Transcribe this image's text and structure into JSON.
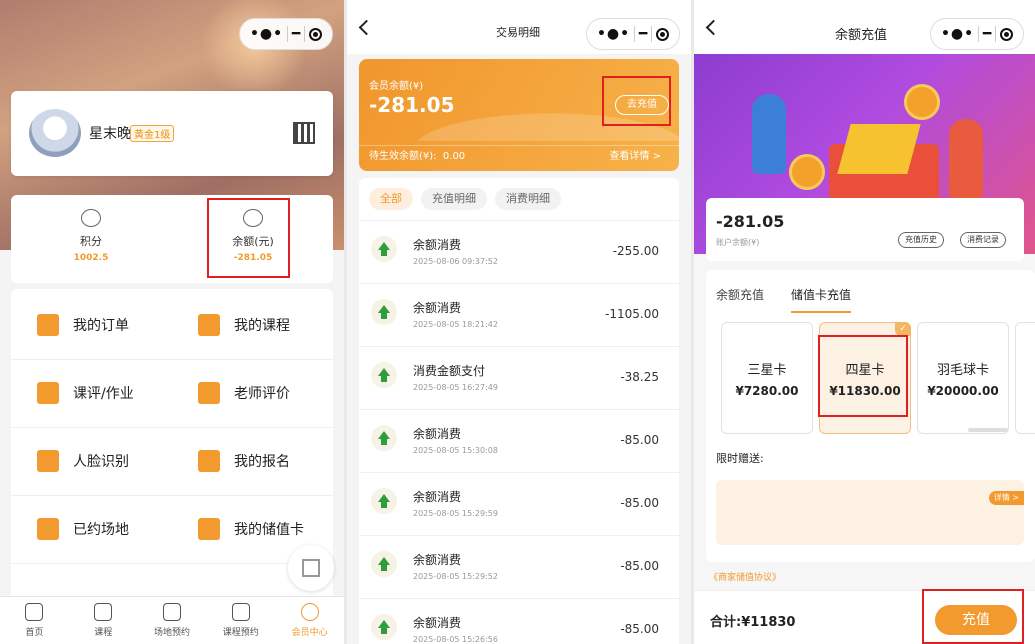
{
  "colors": {
    "accent": "#f29a2e",
    "highlight_box": "#e02020",
    "positive_icon": "#2e9d3a"
  },
  "screen1": {
    "user": {
      "name": "星末晚",
      "level": "黄金1级"
    },
    "stats": [
      {
        "label": "积分",
        "value": "1002.5",
        "icon": "coins-icon"
      },
      {
        "label": "余额(元)",
        "value": "-281.05",
        "icon": "money-bag-icon"
      }
    ],
    "menu": [
      {
        "label": "我的订单",
        "icon": "order-icon"
      },
      {
        "label": "我的课程",
        "icon": "course-icon"
      },
      {
        "label": "课评/作业",
        "icon": "book-icon"
      },
      {
        "label": "老师评价",
        "icon": "star-icon"
      },
      {
        "label": "人脸识别",
        "icon": "face-scan-icon"
      },
      {
        "label": "我的报名",
        "icon": "flag-icon"
      },
      {
        "label": "已约场地",
        "icon": "location-icon"
      },
      {
        "label": "我的储值卡",
        "icon": "card-icon"
      }
    ],
    "tabs": [
      {
        "label": "首页",
        "icon": "home-icon"
      },
      {
        "label": "课程",
        "icon": "bag-icon"
      },
      {
        "label": "场地预约",
        "icon": "venue-icon"
      },
      {
        "label": "课程预约",
        "icon": "clock-icon"
      },
      {
        "label": "会员中心",
        "icon": "user-icon",
        "active": true
      }
    ]
  },
  "screen2": {
    "title": "交易明细",
    "balance_label": "会员余额(¥)",
    "balance": "-281.05",
    "recharge_button": "去充值",
    "pending_label": "待生效余额(¥):",
    "pending_value": "0.00",
    "view_details": "查看详情 >",
    "filters": [
      "全部",
      "充值明细",
      "消费明细"
    ],
    "transactions": [
      {
        "name": "余额消费",
        "time": "2025-08-06 09:37:52",
        "amount": "-255.00"
      },
      {
        "name": "余额消费",
        "time": "2025-08-05 18:21:42",
        "amount": "-1105.00"
      },
      {
        "name": "消费金额支付",
        "time": "2025-08-05 16:27:49",
        "amount": "-38.25"
      },
      {
        "name": "余额消费",
        "time": "2025-08-05 15:30:08",
        "amount": "-85.00"
      },
      {
        "name": "余额消费",
        "time": "2025-08-05 15:29:59",
        "amount": "-85.00"
      },
      {
        "name": "余额消费",
        "time": "2025-08-05 15:29:52",
        "amount": "-85.00"
      },
      {
        "name": "余额消费",
        "time": "2025-08-05 15:26:56",
        "amount": "-85.00"
      }
    ]
  },
  "screen3": {
    "title": "余额充值",
    "balance": "-281.05",
    "balance_label": "账户余额(¥)",
    "history_button": "充值历史",
    "consume_button": "消费记录",
    "tabs": [
      "余额充值",
      "储值卡充值"
    ],
    "cards": [
      {
        "name": "三星卡",
        "price": "¥7280.00"
      },
      {
        "name": "四星卡",
        "price": "¥11830.00",
        "selected": true
      },
      {
        "name": "羽毛球卡",
        "price": "¥20000.00"
      }
    ],
    "gift_label": "限时赠送:",
    "details_button": "详情 >",
    "agreement": "《商家储值协议》",
    "total_label": "合计:",
    "total_value": "¥11830",
    "pay_button": "充值"
  }
}
